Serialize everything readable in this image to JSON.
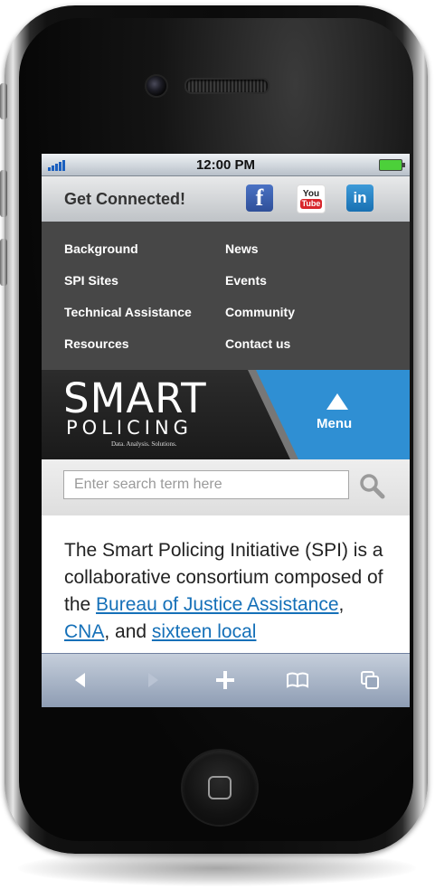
{
  "status_bar": {
    "time": "12:00 PM"
  },
  "header": {
    "title": "Get Connected!",
    "social": [
      {
        "name": "facebook",
        "glyph": "f"
      },
      {
        "name": "youtube",
        "line1": "You",
        "line2": "Tube"
      },
      {
        "name": "linkedin",
        "glyph": "in"
      }
    ]
  },
  "nav": {
    "items": [
      "Background",
      "News",
      "SPI Sites",
      "Events",
      "Technical Assistance",
      "Community",
      "Resources",
      "Contact us"
    ]
  },
  "brand": {
    "logo_top": "SMART",
    "logo_bottom": "POLICING",
    "tagline": "Data. Analysis. Solutions.",
    "menu_label": "Menu"
  },
  "search": {
    "placeholder": "Enter search term here",
    "value": ""
  },
  "content": {
    "intro": "The Smart Policing Initiative (SPI) is a collaborative consortium composed of the ",
    "link1": "Bureau of Justice Assistance",
    "sep1": ", ",
    "link2": "CNA",
    "sep2": ", and ",
    "link3": "sixteen local"
  },
  "colors": {
    "menu_blue": "#2f8fd3",
    "nav_bg": "#474747",
    "link": "#1570b8"
  },
  "toolbar": {
    "icons": [
      "back-icon",
      "forward-icon",
      "add-icon",
      "bookmarks-icon",
      "pages-icon"
    ]
  }
}
